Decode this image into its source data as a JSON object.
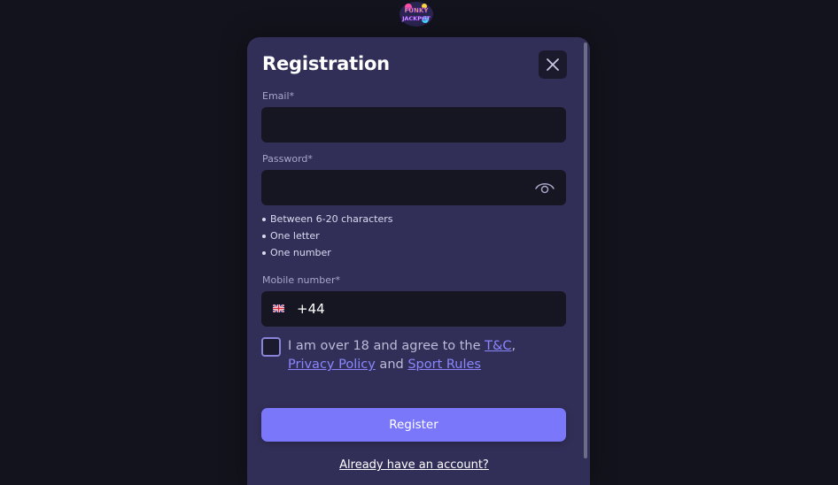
{
  "logo": {
    "text": "FUNKY JACKPOT"
  },
  "modal": {
    "title": "Registration",
    "close_icon": "close-icon"
  },
  "email": {
    "label": "Email*",
    "value": "",
    "placeholder": ""
  },
  "password": {
    "label": "Password*",
    "value": "",
    "placeholder": "",
    "toggle_icon": "eye-icon",
    "rules": [
      "Between 6-20 characters",
      "One letter",
      "One number"
    ]
  },
  "mobile": {
    "label": "Mobile number*",
    "flag_icon": "uk-flag-icon",
    "prefix": "+44"
  },
  "consent": {
    "text_1": "I am over 18 and agree to the ",
    "link_tc": "T&C",
    "sep": ", ",
    "link_privacy": "Privacy Policy",
    "text_2": " and ",
    "link_sport": "Sport Rules"
  },
  "register_button": "Register",
  "login_link": "Already have an account?",
  "colors": {
    "background": "#13131d",
    "modal": "#312f57",
    "input": "#161622",
    "accent": "#7b77fb",
    "link": "#8a86ff"
  }
}
